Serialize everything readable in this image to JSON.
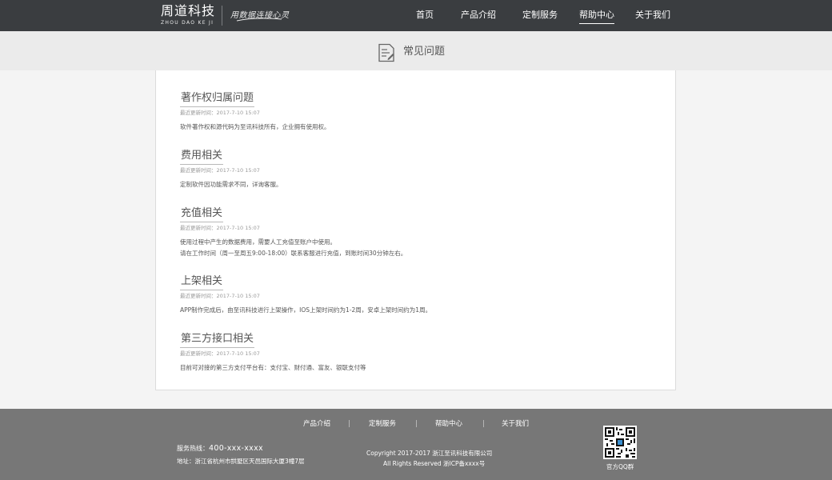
{
  "header": {
    "logo_main": "周道科技",
    "logo_sub": "ZHOU DAO KE JI",
    "slogan": "用数据连接心灵",
    "nav": [
      {
        "label": "首页",
        "active": false
      },
      {
        "label": "产品介绍",
        "active": false
      },
      {
        "label": "定制服务",
        "active": false
      },
      {
        "label": "帮助中心",
        "active": true
      },
      {
        "label": "关于我们",
        "active": false
      }
    ]
  },
  "page": {
    "title": "常见问题",
    "icon": "document-list-icon"
  },
  "faq": [
    {
      "title": "著作权归属问题",
      "date": "最近更新时间：2017-7-10  15:07",
      "body": [
        "软件著作权和源代码为至讯科技所有，企业拥有使用权。"
      ]
    },
    {
      "title": "费用相关",
      "date": "最近更新时间：2017-7-10  15:07",
      "body": [
        "定制软件因功能需求不同，详询客服。"
      ]
    },
    {
      "title": "充值相关",
      "date": "最近更新时间：2017-7-10  15:07",
      "body": [
        "使用过程中产生的数据费用，需要人工充值至账户中使用。",
        "请在工作时间（周一至周五9:00-18:00）联系客服进行充值，到账时间30分钟左右。"
      ]
    },
    {
      "title": "上架相关",
      "date": "最近更新时间：2017-7-10  15:07",
      "body": [
        "APP制作完成后，由至讯科技进行上架操作，IOS上架时间约为1-2周，安卓上架时间约为1周。"
      ]
    },
    {
      "title": "第三方接口相关",
      "date": "最近更新时间：2017-7-10  15:07",
      "body": [
        "目前可对接的第三方支付平台有：支付宝、财付通、富友、银联支付等"
      ]
    }
  ],
  "footer": {
    "nav": [
      "产品介绍",
      "定制服务",
      "帮助中心",
      "关于我们"
    ],
    "hotline_label": "服务热线：",
    "hotline_number": "400-xxx-xxxx",
    "address": "地址：浙江省杭州市拱墅区天邑国际大厦3幢7层",
    "copyright": "Copyright 2017-2017    浙江至讯科技有限公司",
    "rights": "All Rights Reserved 浙ICP备xxxx号",
    "qr_label": "官方QQ群",
    "qr_icon": "qr-code-icon"
  },
  "colors": {
    "header_bg": "#3a3d40",
    "title_band_bg": "#ebebeb",
    "footer_bg": "#777777",
    "card_bg": "#ffffff"
  }
}
